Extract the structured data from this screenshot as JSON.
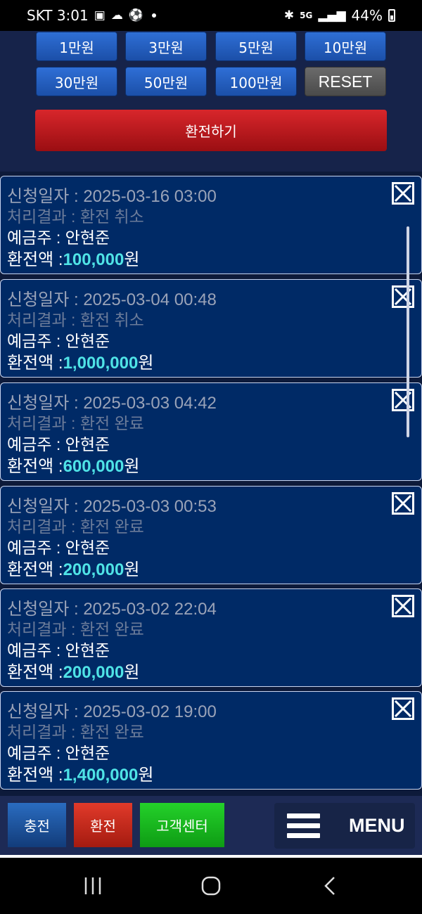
{
  "status_bar": {
    "carrier_time": "SKT 3:01",
    "left_icons": [
      "gallery-icon",
      "cloud-icon",
      "soccer-ball-icon"
    ],
    "right_icons": [
      "bluetooth-icon",
      "5g-icon",
      "signal-icon"
    ],
    "battery": "44%"
  },
  "amount_buttons": {
    "row1": [
      "1만원",
      "3만원",
      "5만원",
      "10만원"
    ],
    "row2": [
      "30만원",
      "50만원",
      "100만원"
    ],
    "reset": "RESET"
  },
  "exchange_button": "환전하기",
  "labels": {
    "date": "신청일자 : ",
    "result": "처리결과 : ",
    "depositor": "예금주 : ",
    "amount": "환전액 :",
    "unit": "원"
  },
  "records": [
    {
      "date": "2025-03-16 03:00",
      "result": "환전 취소",
      "depositor": "안현준",
      "amount": "100,000"
    },
    {
      "date": "2025-03-04 00:48",
      "result": "환전 취소",
      "depositor": "안현준",
      "amount": "1,000,000"
    },
    {
      "date": "2025-03-03 04:42",
      "result": "환전 완료",
      "depositor": "안현준",
      "amount": "600,000"
    },
    {
      "date": "2025-03-03 00:53",
      "result": "환전 완료",
      "depositor": "안현준",
      "amount": "200,000"
    },
    {
      "date": "2025-03-02 22:04",
      "result": "환전 완료",
      "depositor": "안현준",
      "amount": "200,000"
    },
    {
      "date": "2025-03-02 19:00",
      "result": "환전 완료",
      "depositor": "안현준",
      "amount": "1,400,000"
    }
  ],
  "bottom_nav": {
    "charge": "충전",
    "exchange": "환전",
    "support": "고객센터",
    "menu": "MENU"
  }
}
